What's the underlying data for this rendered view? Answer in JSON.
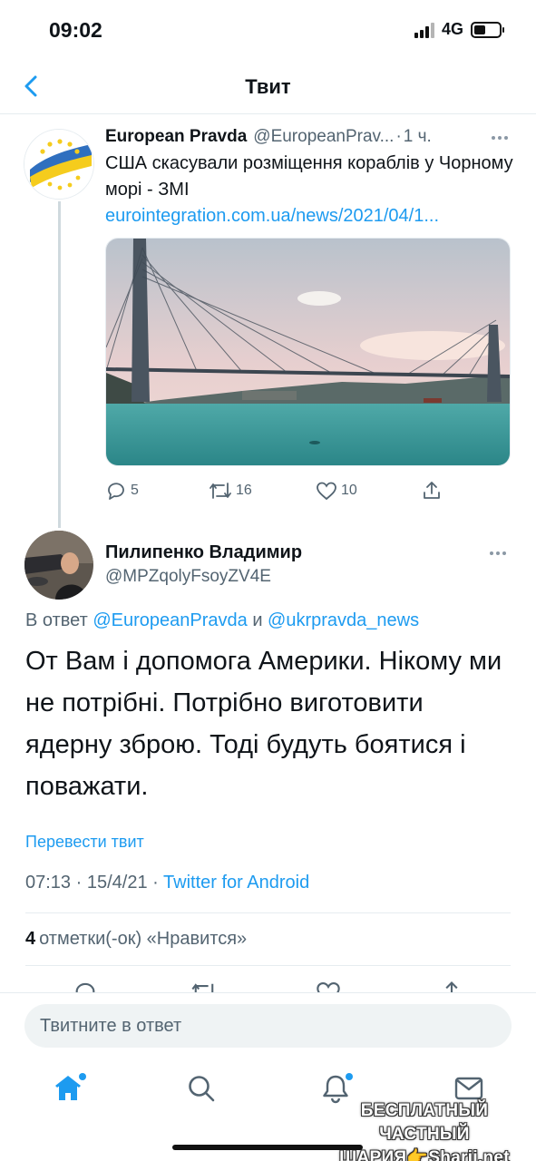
{
  "status_bar": {
    "time": "09:02",
    "network": "4G"
  },
  "nav": {
    "title": "Твит"
  },
  "quoted_tweet": {
    "name": "European Pravda",
    "handle": "@EuropeanPrav...",
    "separator": "·",
    "time": "1 ч.",
    "text": "США скасували розміщення кораблів у Чорному морі - ЗМІ",
    "link": "eurointegration.com.ua/news/2021/04/1...",
    "replies": "5",
    "retweets": "16",
    "likes": "10"
  },
  "main_tweet": {
    "name": "Пилипенко Владимир",
    "handle": "@MPZqolyFsoyZV4E",
    "reply_prefix": "В ответ",
    "reply_mention_1": "@EuropeanPravda",
    "reply_and": "и",
    "reply_mention_2": "@ukrpravda_news",
    "text": "От Вам і допомога Америки. Нікому ми не потрібні. Потрібно виготовити ядерну зброю. Тоді будуть боятися і поважати.",
    "translate": "Перевести твит",
    "time": "07:13",
    "date": "15/4/21",
    "separator": "·",
    "source": "Twitter for Android",
    "likes_count": "4",
    "likes_label": "отметки(-ок) «Нравится»"
  },
  "compose": {
    "placeholder": "Твитните в ответ"
  },
  "watermark": {
    "line1": "БЕСПЛАТНЫЙ ЧАСТНЫЙ",
    "line2": "ШАРИЯ👉Sharij.net"
  },
  "colors": {
    "accent": "#1d9bf0",
    "secondary_text": "#536471"
  },
  "icons": [
    "back-chevron-icon",
    "more-dots-icon",
    "reply-icon",
    "retweet-icon",
    "like-icon",
    "share-icon",
    "home-icon",
    "search-icon",
    "notifications-icon",
    "messages-icon"
  ]
}
